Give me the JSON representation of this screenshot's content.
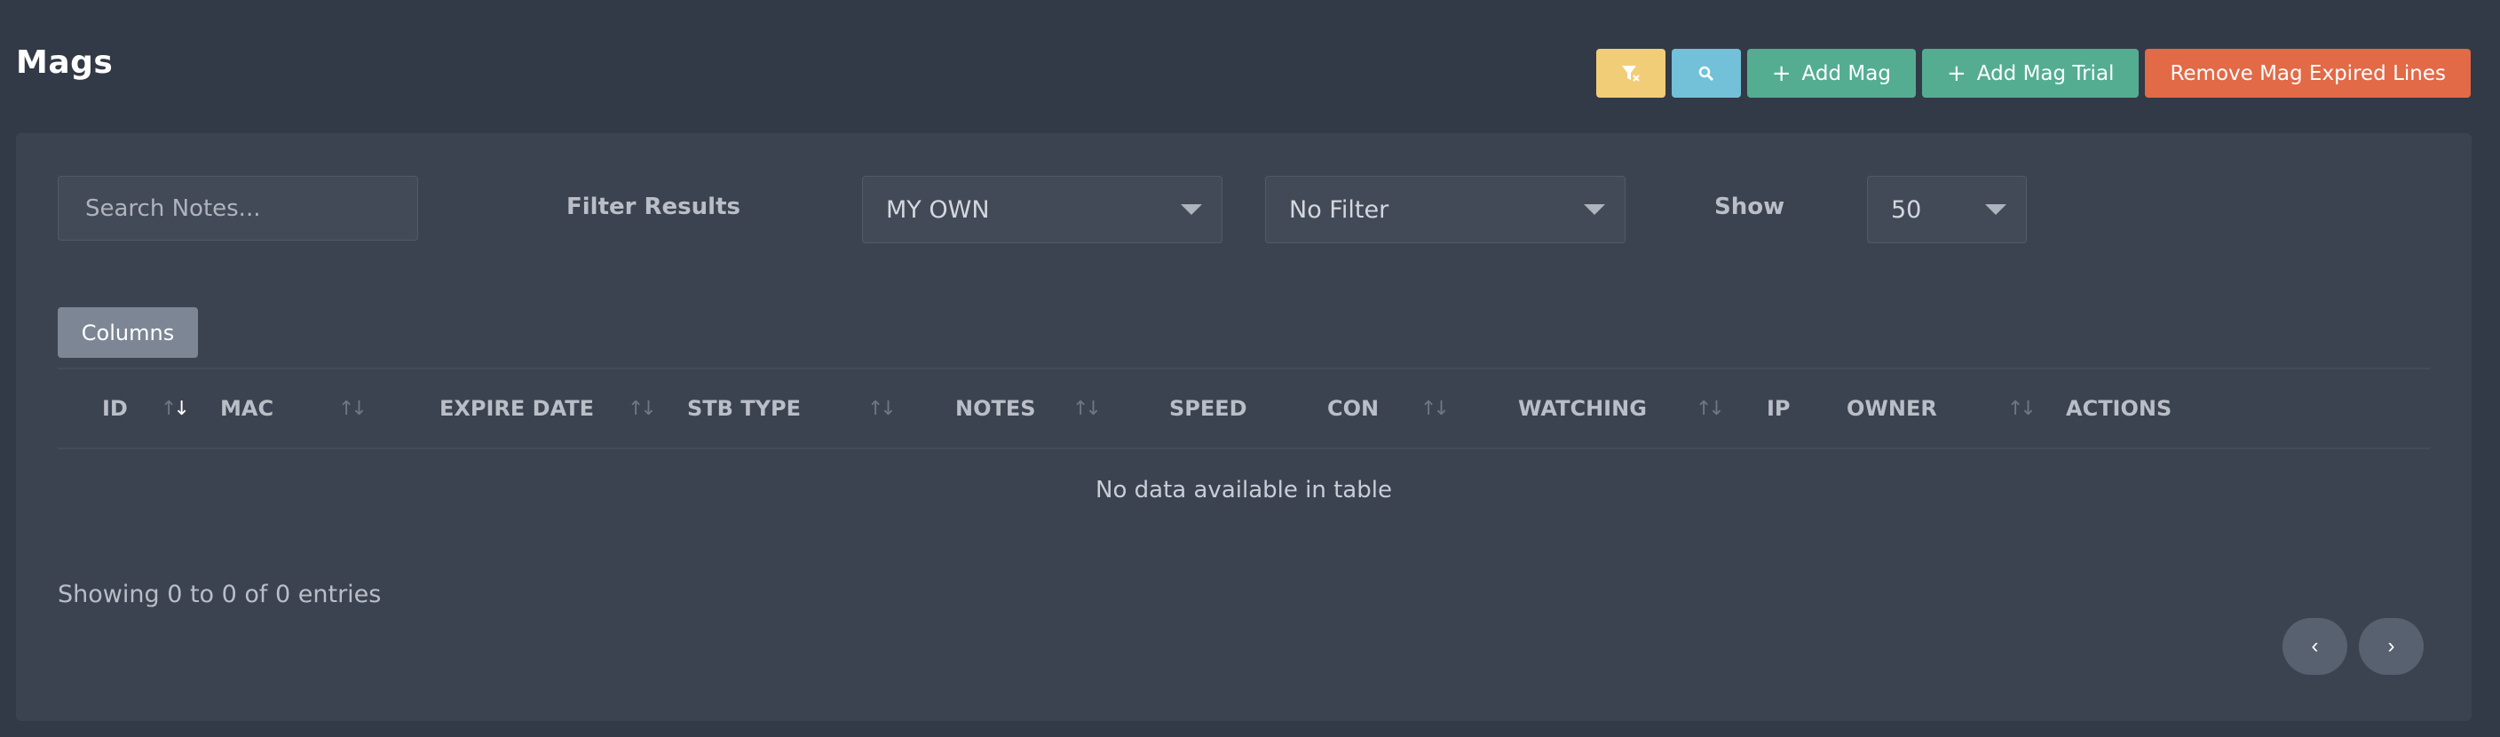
{
  "page": {
    "title": "Mags"
  },
  "toolbar": {
    "add_mag": "Add Mag",
    "add_mag_trial": "Add Mag Trial",
    "remove_expired": "Remove Mag Expired Lines",
    "plus_glyph": "+",
    "clear_filter_icon": "filter-clear-icon",
    "search_icon": "search-icon",
    "colors": {
      "yellow": "#f2cd77",
      "cyan": "#73c1d8",
      "green": "#54ad91",
      "orange": "#e26a47"
    }
  },
  "filters": {
    "search_placeholder": "Search Notes...",
    "filter_label": "Filter Results",
    "owner_select": "MY OWN",
    "status_select": "No Filter",
    "show_label": "Show",
    "page_size": "50"
  },
  "table": {
    "columns_button": "Columns",
    "headers": [
      "ID",
      "MAC",
      "EXPIRE DATE",
      "STB TYPE",
      "NOTES",
      "SPEED",
      "CON",
      "WATCHING",
      "IP",
      "OWNER",
      "ACTIONS"
    ],
    "sort_glyph": "↑↓",
    "empty_message": "No data available in table",
    "info": "Showing 0 to 0 of 0 entries"
  },
  "pagination": {
    "prev": "‹",
    "next": "›"
  }
}
